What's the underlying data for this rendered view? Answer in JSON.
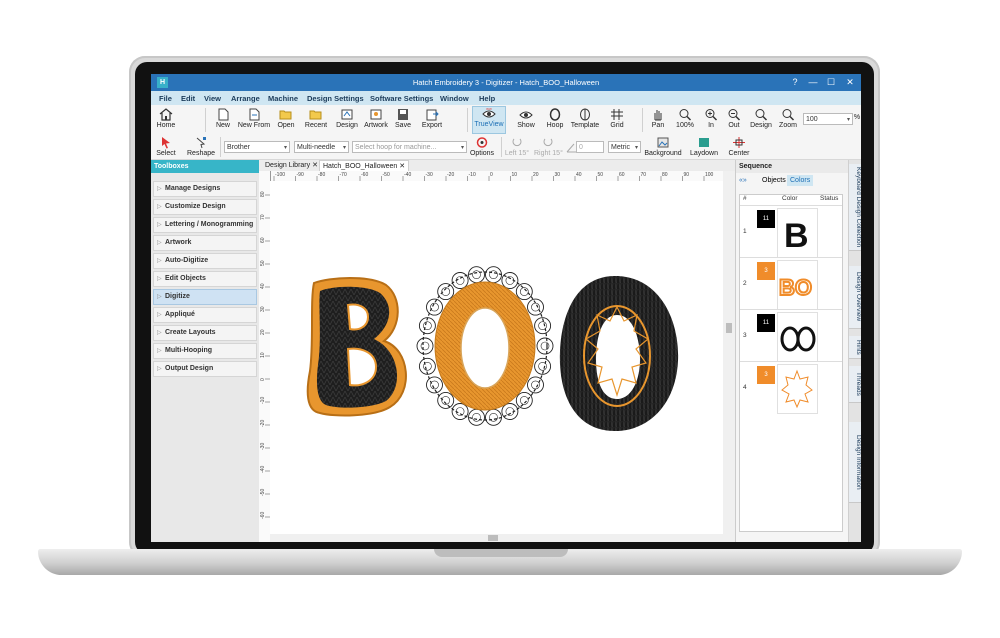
{
  "window": {
    "app_icon": "Hatch",
    "title": "Hatch Embroidery 3 - Digitizer - Hatch_BOO_Halloween",
    "controls": [
      "?",
      "—",
      "☐",
      "✕"
    ]
  },
  "menu": [
    "File",
    "Edit",
    "View",
    "Arrange",
    "Machine",
    "Design Settings",
    "Software Settings",
    "Window",
    "Help"
  ],
  "toolbar1": {
    "home": "Home",
    "new": "New",
    "new_from": "New From",
    "open": "Open",
    "recent": "Recent",
    "design": "Design",
    "artwork": "Artwork",
    "save": "Save",
    "export": "Export",
    "trueview": "TrueView",
    "show": "Show",
    "hoop": "Hoop",
    "template": "Template",
    "grid": "Grid",
    "pan": "Pan",
    "zoom_100": "100%",
    "zoom_in": "In",
    "zoom_out": "Out",
    "zoom_design": "Design",
    "zoom": "Zoom",
    "zoom_value": "100",
    "zoom_unit": "%"
  },
  "toolbar2": {
    "select": "Select",
    "reshape": "Reshape",
    "machine_brand": "Brother",
    "machine_type": "Multi-needle",
    "hoop_placeholder": "Select hoop for machine...",
    "options": "Options",
    "left15": "Left 15°",
    "right15": "Right 15°",
    "rotation_value": "0",
    "units": "Metric",
    "background": "Background",
    "laydown": "Laydown",
    "center": "Center"
  },
  "toolboxes": {
    "title": "Toolboxes",
    "items": [
      {
        "label": "Manage Designs"
      },
      {
        "label": "Customize Design"
      },
      {
        "label": "Lettering / Monogramming"
      },
      {
        "label": "Artwork"
      },
      {
        "label": "Auto-Digitize"
      },
      {
        "label": "Edit Objects"
      },
      {
        "label": "Digitize",
        "selected": true
      },
      {
        "label": "Appliqué"
      },
      {
        "label": "Create Layouts"
      },
      {
        "label": "Multi-Hooping"
      },
      {
        "label": "Output Design"
      }
    ]
  },
  "doc_tabs": [
    {
      "label": "Design Library",
      "close": "✕"
    },
    {
      "label": "Hatch_BOO_Halloween",
      "close": "✕",
      "active": true
    }
  ],
  "ruler": {
    "h_ticks": [
      "-100",
      "-90",
      "-80",
      "-70",
      "-60",
      "-50",
      "-40",
      "-30",
      "-20",
      "-10",
      "0",
      "10",
      "20",
      "30",
      "40",
      "50",
      "60",
      "70",
      "80",
      "90",
      "100"
    ],
    "v_ticks": [
      "80",
      "70",
      "60",
      "50",
      "40",
      "30",
      "20",
      "10",
      "0",
      "-10",
      "-20",
      "-30",
      "-40",
      "-50",
      "-60"
    ]
  },
  "sequence": {
    "title": "Sequence",
    "tab_objects": "Objects",
    "tab_colors": "Colors",
    "col_hash": "#",
    "col_color": "Color",
    "col_status": "Status",
    "rows": [
      {
        "num": "1",
        "swatch": "11",
        "color": "#000000"
      },
      {
        "num": "2",
        "swatch": "3",
        "color": "#f08c2a"
      },
      {
        "num": "3",
        "swatch": "11",
        "color": "#000000"
      },
      {
        "num": "4",
        "swatch": "3",
        "color": "#f08c2a"
      }
    ]
  },
  "dock": [
    "Keyboard Design Collection",
    "Design Overview",
    "Hints",
    "Threads",
    "Design Information"
  ],
  "colors": {
    "titlebar": "#2a73b8",
    "menubar": "#cfe6f2",
    "toolbox_header": "#37b5c8",
    "orange_thread": "#e8962e",
    "black_thread": "#1e1e1e"
  },
  "icons": [
    "home-icon",
    "new-icon",
    "open-icon",
    "save-icon",
    "export-icon",
    "trueview-icon",
    "hoop-icon",
    "grid-icon",
    "pan-icon",
    "zoom-icon",
    "select-arrow-icon",
    "reshape-icon"
  ]
}
